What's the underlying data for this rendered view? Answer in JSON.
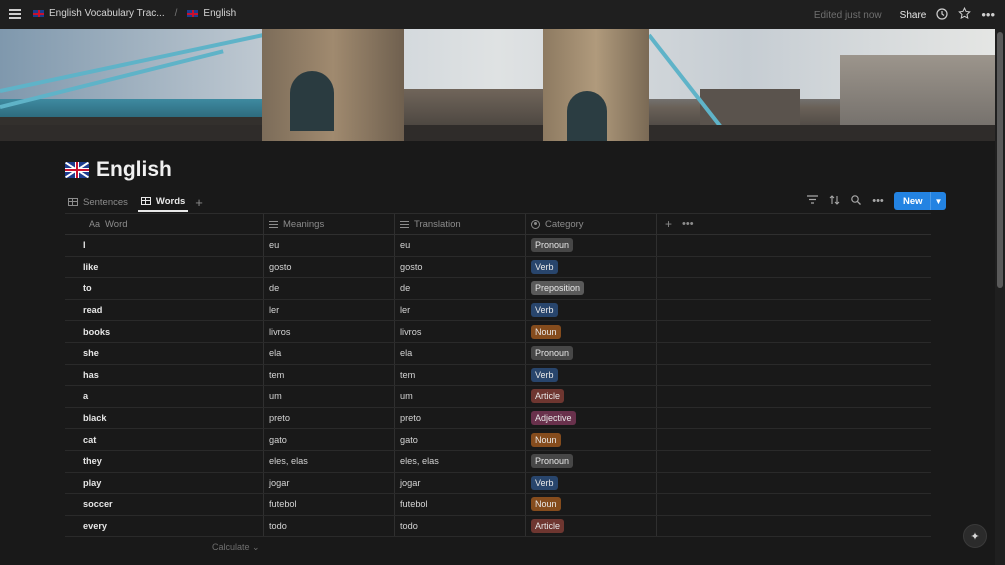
{
  "breadcrumbs": [
    {
      "label": "English Vocabulary Trac..."
    },
    {
      "label": "English"
    }
  ],
  "status": {
    "edited": "Edited just now"
  },
  "topbar": {
    "share_label": "Share"
  },
  "page": {
    "title": "English"
  },
  "views": [
    {
      "label": "Sentences",
      "active": false
    },
    {
      "label": "Words",
      "active": true
    }
  ],
  "toolbar": {
    "new_label": "New"
  },
  "columns": {
    "word": "Word",
    "word_prefix": "Aa",
    "meanings": "Meanings",
    "translation": "Translation",
    "category": "Category"
  },
  "category_colors": {
    "Pronoun": "#474747",
    "Verb": "#28456c",
    "Preposition": "#5a5a5a",
    "Noun": "#854c1d",
    "Article": "#6e3630",
    "Adjective": "#69314c"
  },
  "rows": [
    {
      "word": "I",
      "meanings": "eu",
      "translation": "eu",
      "category": "Pronoun"
    },
    {
      "word": "like",
      "meanings": "gosto",
      "translation": "gosto",
      "category": "Verb"
    },
    {
      "word": "to",
      "meanings": "de",
      "translation": "de",
      "category": "Preposition"
    },
    {
      "word": "read",
      "meanings": "ler",
      "translation": "ler",
      "category": "Verb"
    },
    {
      "word": "books",
      "meanings": "livros",
      "translation": "livros",
      "category": "Noun"
    },
    {
      "word": "she",
      "meanings": "ela",
      "translation": "ela",
      "category": "Pronoun"
    },
    {
      "word": "has",
      "meanings": "tem",
      "translation": "tem",
      "category": "Verb"
    },
    {
      "word": "a",
      "meanings": "um",
      "translation": "um",
      "category": "Article"
    },
    {
      "word": "black",
      "meanings": "preto",
      "translation": "preto",
      "category": "Adjective"
    },
    {
      "word": "cat",
      "meanings": "gato",
      "translation": "gato",
      "category": "Noun"
    },
    {
      "word": "they",
      "meanings": "eles, elas",
      "translation": "eles, elas",
      "category": "Pronoun"
    },
    {
      "word": "play",
      "meanings": "jogar",
      "translation": "jogar",
      "category": "Verb"
    },
    {
      "word": "soccer",
      "meanings": "futebol",
      "translation": "futebol",
      "category": "Noun"
    },
    {
      "word": "every",
      "meanings": "todo",
      "translation": "todo",
      "category": "Article"
    }
  ],
  "footer": {
    "calculate_label": "Calculate"
  }
}
